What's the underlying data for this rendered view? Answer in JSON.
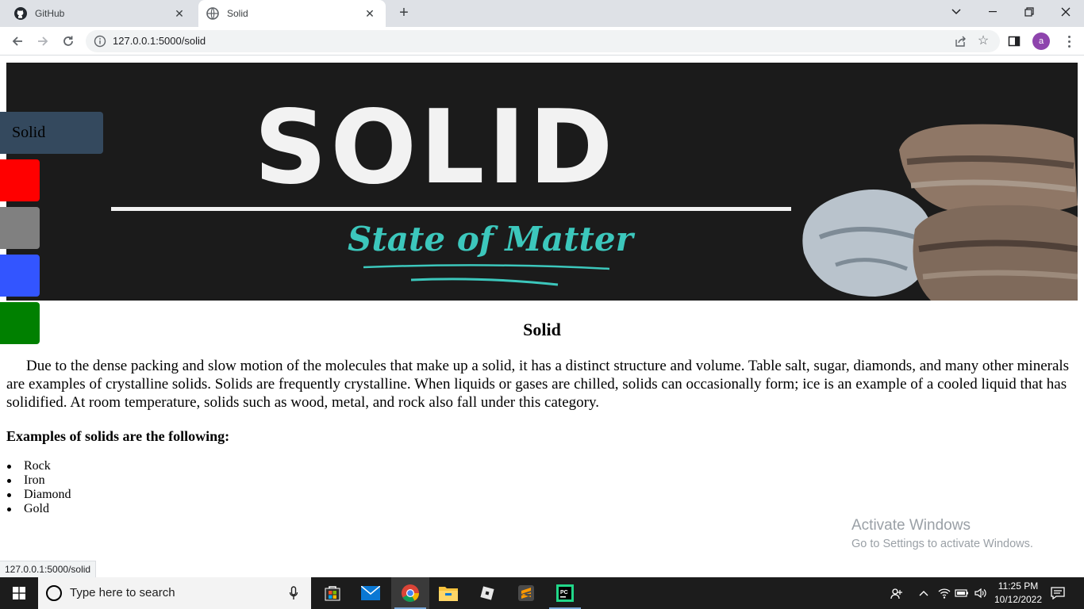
{
  "browser": {
    "tabs": [
      {
        "title": "GitHub",
        "active": false,
        "icon": "github-icon"
      },
      {
        "title": "Solid",
        "active": true,
        "icon": "globe-icon"
      }
    ],
    "url": "127.0.0.1:5000/solid",
    "profile_initial": "a",
    "status_url": "127.0.0.1:5000/solid"
  },
  "banner": {
    "title": "SOLID",
    "subtitle": "State of Matter"
  },
  "side_nav": {
    "items": [
      {
        "label": "Solid",
        "color": "#34495e"
      },
      {
        "label": "",
        "color": "#ff0000"
      },
      {
        "label": "",
        "color": "#808080"
      },
      {
        "label": "",
        "color": "#3355ff"
      },
      {
        "label": "",
        "color": "#008000"
      }
    ]
  },
  "content": {
    "heading": "Solid",
    "paragraph": "Due to the dense packing and slow motion of the molecules that make up a solid, it has a distinct structure and volume. Table salt, sugar, diamonds, and many other minerals are examples of crystalline solids. Solids are frequently crystalline. When liquids or gases are chilled, solids can occasionally form; ice is an example of a cooled liquid that has solidified. At room temperature, solids such as wood, metal, and rock also fall under this category.",
    "examples_heading": "Examples of solids are the following:",
    "examples": [
      "Rock",
      "Iron",
      "Diamond",
      "Gold"
    ]
  },
  "watermark": {
    "title": "Activate Windows",
    "subtitle": "Go to Settings to activate Windows."
  },
  "taskbar": {
    "search_placeholder": "Type here to search",
    "apps": [
      "microsoft-store-icon",
      "mail-icon",
      "chrome-icon",
      "file-explorer-icon",
      "roblox-icon",
      "sublime-text-icon",
      "pycharm-icon"
    ],
    "time": "11:25 PM",
    "date": "10/12/2022"
  },
  "colors": {
    "accent_profile": "#8e44ad",
    "banner_bg": "#1b1b1b",
    "banner_subtitle": "#3cc7bc"
  }
}
